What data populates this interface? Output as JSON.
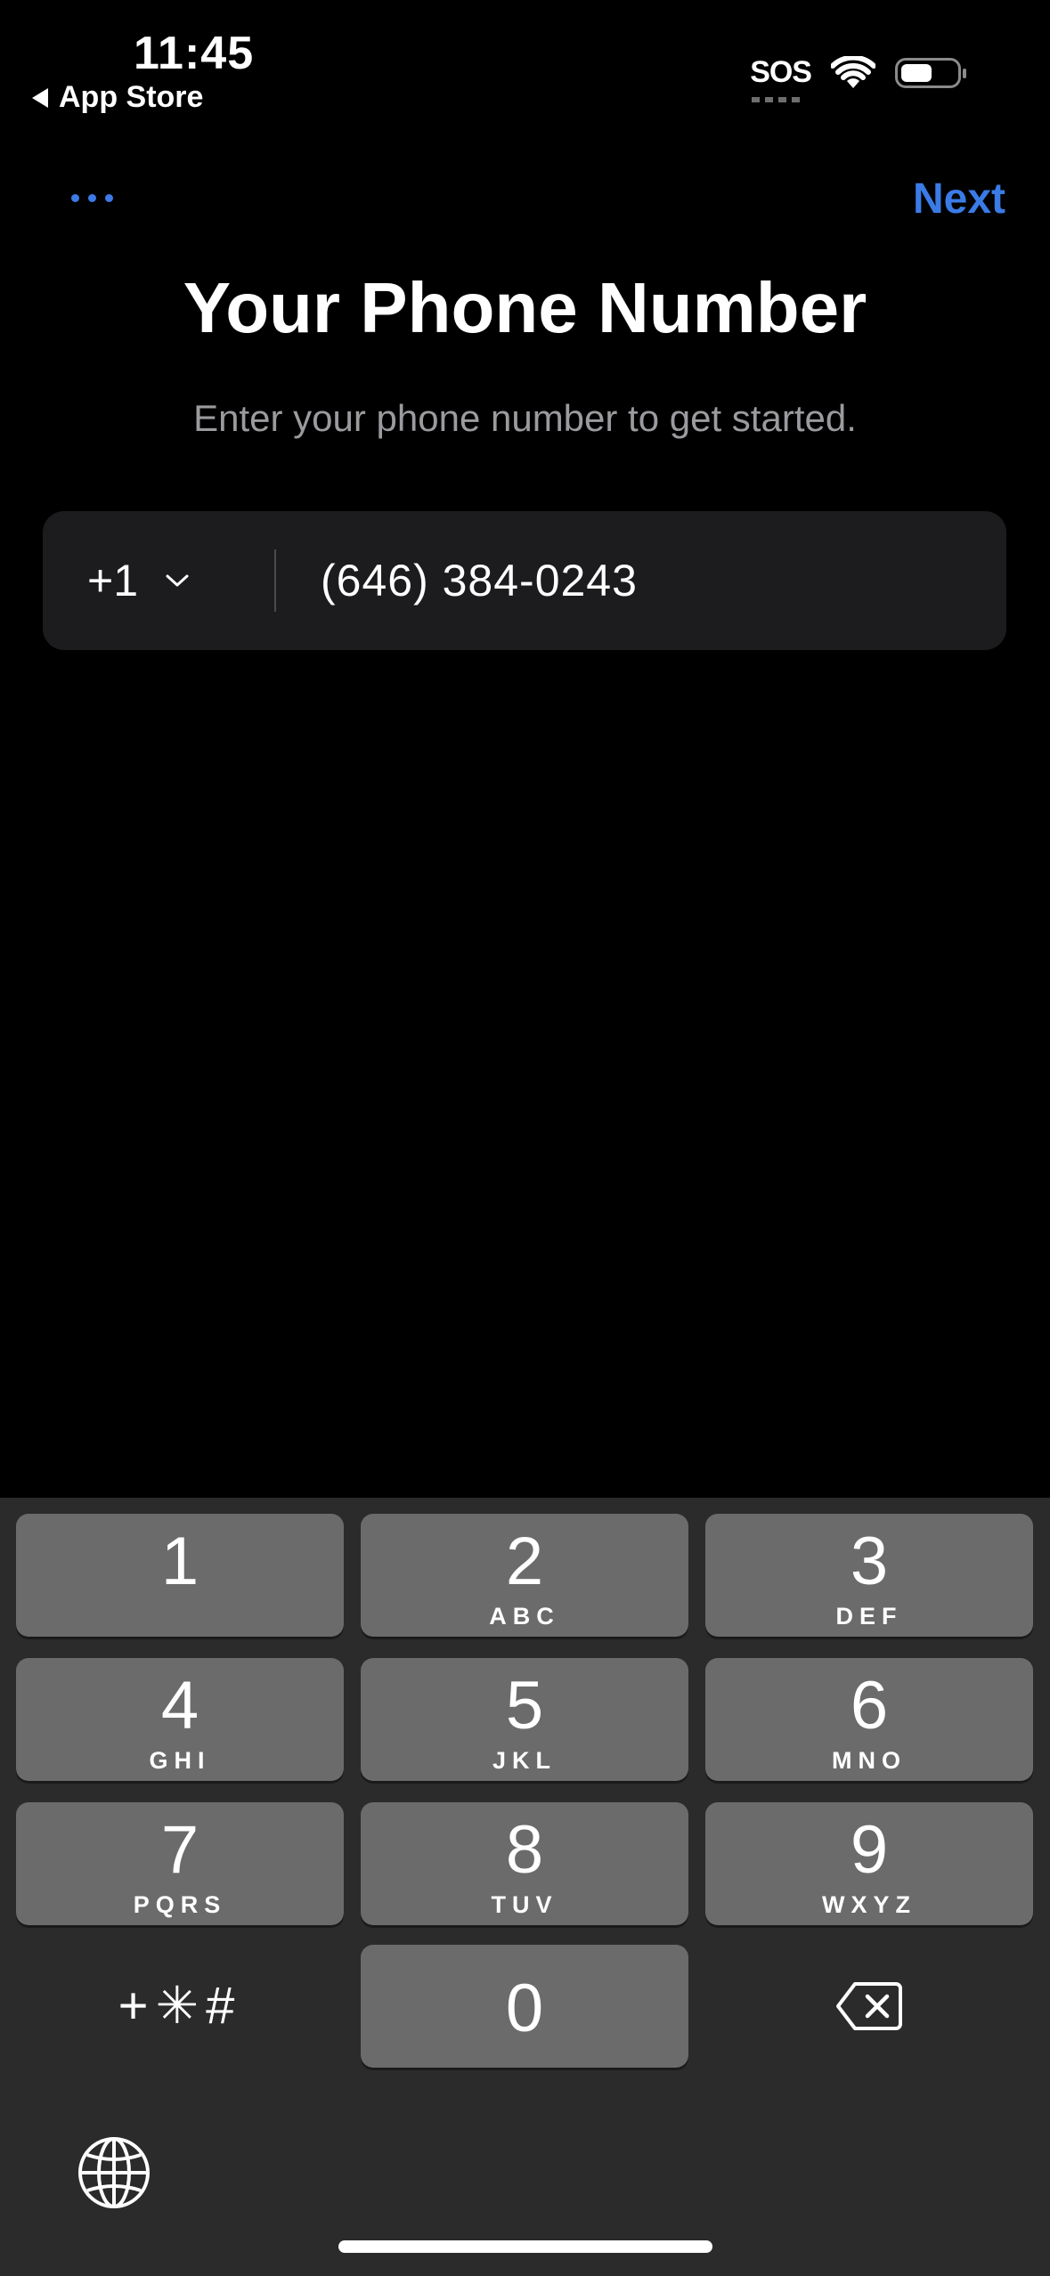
{
  "status_bar": {
    "time": "11:45",
    "back_label": "App Store",
    "sos": "SOS",
    "icons": [
      "wifi-icon",
      "battery-icon"
    ]
  },
  "nav": {
    "more_icon": "ellipsis-icon",
    "next_label": "Next"
  },
  "header": {
    "title": "Your Phone Number",
    "subtitle": "Enter your phone number to get started."
  },
  "phone_input": {
    "country_code": "+1",
    "number": "(646) 384-0243"
  },
  "keypad": {
    "keys": [
      {
        "digit": "1",
        "letters": ""
      },
      {
        "digit": "2",
        "letters": "ABC"
      },
      {
        "digit": "3",
        "letters": "DEF"
      },
      {
        "digit": "4",
        "letters": "GHI"
      },
      {
        "digit": "5",
        "letters": "JKL"
      },
      {
        "digit": "6",
        "letters": "MNO"
      },
      {
        "digit": "7",
        "letters": "PQRS"
      },
      {
        "digit": "8",
        "letters": "TUV"
      },
      {
        "digit": "9",
        "letters": "WXYZ"
      },
      {
        "digit": "0",
        "letters": ""
      }
    ],
    "symbols_label": "+✳#",
    "delete_icon": "backspace-icon",
    "globe_icon": "globe-icon"
  },
  "colors": {
    "accent": "#3a7be6",
    "background": "#000000",
    "field_bg": "#1c1c1e",
    "keyboard_bg": "#2b2b2b",
    "key_bg": "#6b6b6b"
  }
}
